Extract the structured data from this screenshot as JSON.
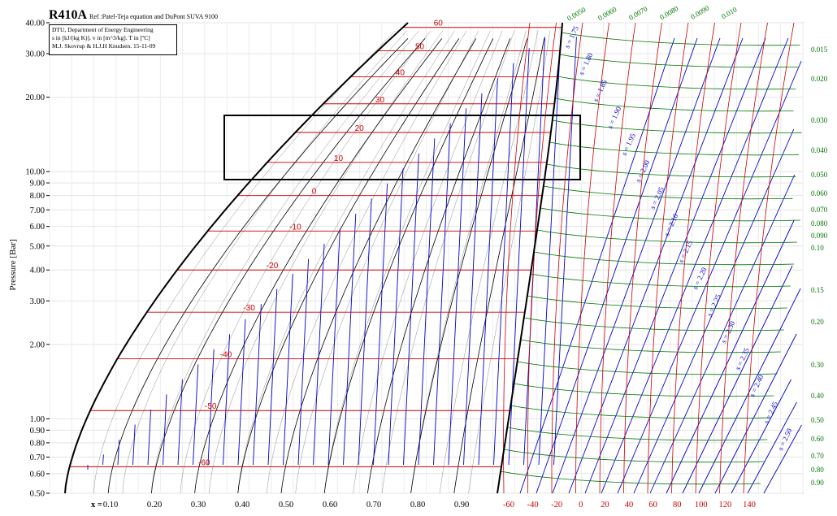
{
  "header": {
    "title": "R410A",
    "ref": "Ref :Patel-Teja equation and DuPont SUVA 9100"
  },
  "infobox": {
    "line1": "DTU, Department of Energy Engineering",
    "line2": "s in [kJ/(kg K)]. v in [m^3/kg]. T in [ºC]",
    "line3": "M.J. Skovrup & H.J.H Knudsen. 15-11-09"
  },
  "chart_data": {
    "type": "line",
    "title": "R410A",
    "ylabel": "Pressure [Bar]",
    "y_scale": "log",
    "ylim": [
      0.5,
      40
    ],
    "y_ticks": [
      "0.50",
      "0.60",
      "0.70",
      "0.80",
      "0.90",
      "1.00",
      "2.00",
      "3.00",
      "4.00",
      "5.00",
      "6.00",
      "7.00",
      "8.00",
      "9.00",
      "10.00",
      "20.00",
      "30.00",
      "40.00"
    ],
    "x_quality_prefix": "x =",
    "x_quality_ticks": [
      "0.10",
      "0.20",
      "0.30",
      "0.40",
      "0.50",
      "0.60",
      "0.70",
      "0.80",
      "0.90"
    ],
    "x_temperature_ticks": [
      "-60",
      "-40",
      "-20",
      "0",
      "20",
      "40",
      "60",
      "80",
      "100",
      "120",
      "140"
    ],
    "isotherm_labels": [
      "60",
      "50",
      "40",
      "30",
      "20",
      "10",
      "0",
      "-10",
      "-20",
      "-30",
      "-40",
      "-50",
      "-60"
    ],
    "entropy_labels": [
      "s = 1.75",
      "s = 1.80",
      "s = 1.85",
      "s = 1.90",
      "s = 1.95",
      "s = 2.00",
      "s = 2.05",
      "s = 2.10",
      "s = 2.15",
      "s = 2.20",
      "s = 2.25",
      "s = 2.30",
      "s = 2.35",
      "s = 2.40",
      "s = 2.45",
      "s = 2.50"
    ],
    "volume_labels_top": [
      "0.0050",
      "0.0060",
      "0.0070",
      "0.0080",
      "0.0090",
      "0.010"
    ],
    "volume_labels_right": [
      "0.015",
      "0.020",
      "0.030",
      "0.040",
      "0.050",
      "0.060",
      "0.070",
      "0.080",
      "0.090",
      "0.10",
      "0.15",
      "0.20",
      "0.30",
      "0.40",
      "0.50",
      "0.60",
      "0.70",
      "0.80",
      "0.90"
    ],
    "grid": true,
    "colors": {
      "saturation": "#000000",
      "isotherm": "#cc0000",
      "isentrope": "#0000cc",
      "isochore": "#007700",
      "quality": "#000000"
    }
  }
}
